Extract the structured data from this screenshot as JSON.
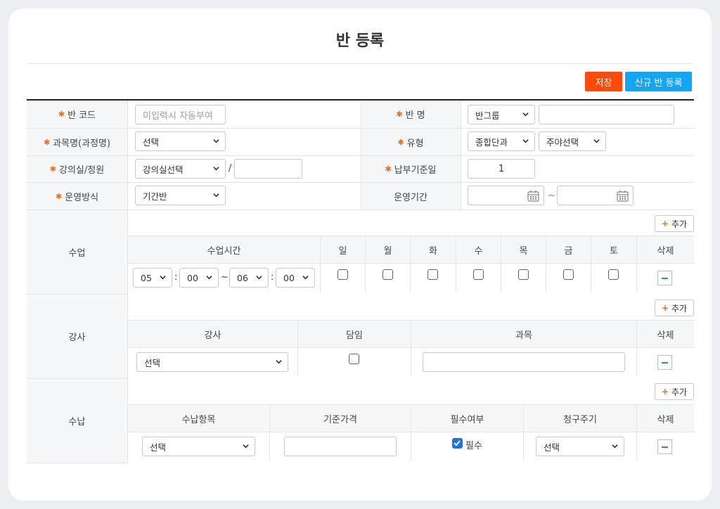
{
  "page": {
    "title": "반 등록"
  },
  "toolbar": {
    "save_label": "저장",
    "new_label": "신규 반 등록"
  },
  "form": {
    "class_code": {
      "label": "반 코드",
      "placeholder": "미입력시 자동부여"
    },
    "class_name": {
      "label": "반 명",
      "group_select": "반그룹",
      "value": ""
    },
    "subject": {
      "label": "과목명(과정명)",
      "select": "선택"
    },
    "type": {
      "label": "유형",
      "select": "종합단과",
      "day_select": "주야선택"
    },
    "room": {
      "label": "강의실/정원",
      "select": "강의실선택",
      "separator": "/",
      "capacity": ""
    },
    "pay_day": {
      "label": "납부기준일",
      "value": "1"
    },
    "operation": {
      "label": "운영방식",
      "select": "기간반"
    },
    "period": {
      "label": "운영기간",
      "tilde": "~"
    }
  },
  "lesson": {
    "label": "수업",
    "add_label": "추가",
    "headers": [
      "수업시간",
      "일",
      "월",
      "화",
      "수",
      "목",
      "금",
      "토",
      "삭제"
    ],
    "row": {
      "start_h": "05",
      "start_m": "00",
      "end_h": "06",
      "end_m": "00",
      "colon": ":",
      "tilde": "~"
    }
  },
  "teacher": {
    "label": "강사",
    "add_label": "추가",
    "headers": [
      "강사",
      "담임",
      "과목",
      "삭제"
    ],
    "row": {
      "select": "선택"
    }
  },
  "payment": {
    "label": "수납",
    "add_label": "추가",
    "headers": [
      "수납항목",
      "기준가격",
      "필수여부",
      "청구주기",
      "삭제"
    ],
    "row": {
      "item_select": "선택",
      "required_label": "필수",
      "cycle_select": "선택"
    }
  },
  "colors": {
    "save": "#ff4a0a",
    "new": "#14a5f5",
    "required_mark": "#f26b1d",
    "delete_icon": "#1a8be6",
    "checkbox_on": "#1a73e8"
  }
}
